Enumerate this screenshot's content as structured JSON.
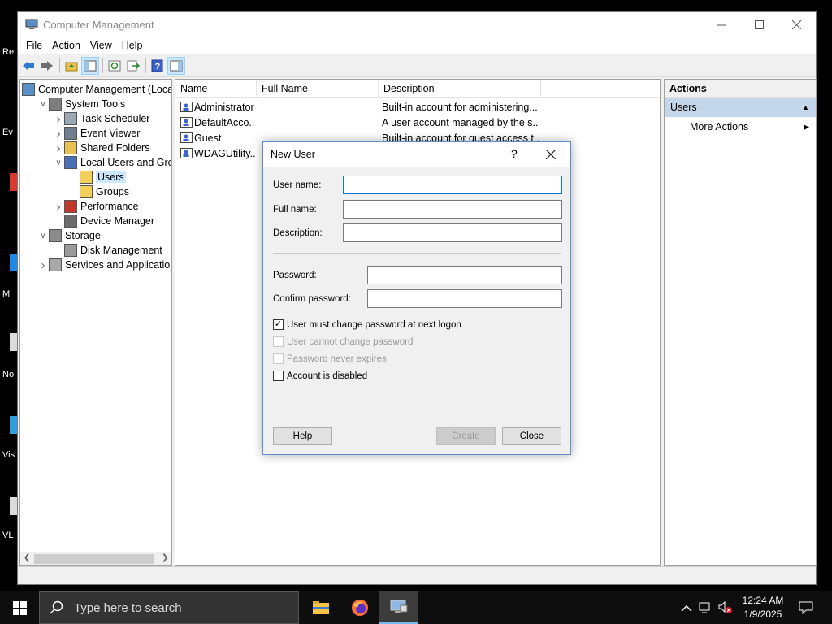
{
  "window": {
    "title": "Computer Management"
  },
  "menu": [
    "File",
    "Action",
    "View",
    "Help"
  ],
  "tree": [
    {
      "label": "Computer Management (Local",
      "level": 0,
      "arrow": "",
      "icon": "computer-mgmt-icon"
    },
    {
      "label": "System Tools",
      "level": 1,
      "arrow": "v",
      "icon": "tools-icon"
    },
    {
      "label": "Task Scheduler",
      "level": 2,
      "arrow": ">",
      "icon": "clock-icon"
    },
    {
      "label": "Event Viewer",
      "level": 2,
      "arrow": ">",
      "icon": "event-viewer-icon"
    },
    {
      "label": "Shared Folders",
      "level": 2,
      "arrow": ">",
      "icon": "shared-folder-icon"
    },
    {
      "label": "Local Users and Groups",
      "level": 2,
      "arrow": "v",
      "icon": "users-groups-icon"
    },
    {
      "label": "Users",
      "level": 3,
      "arrow": "",
      "icon": "folder-icon",
      "selected": true
    },
    {
      "label": "Groups",
      "level": 3,
      "arrow": "",
      "icon": "folder-icon"
    },
    {
      "label": "Performance",
      "level": 2,
      "arrow": ">",
      "icon": "performance-icon"
    },
    {
      "label": "Device Manager",
      "level": 2,
      "arrow": "",
      "icon": "device-manager-icon"
    },
    {
      "label": "Storage",
      "level": 1,
      "arrow": "v",
      "icon": "storage-icon"
    },
    {
      "label": "Disk Management",
      "level": 2,
      "arrow": "",
      "icon": "disk-icon"
    },
    {
      "label": "Services and Applications",
      "level": 1,
      "arrow": ">",
      "icon": "services-icon"
    }
  ],
  "list": {
    "columns": [
      "Name",
      "Full Name",
      "Description"
    ],
    "rows": [
      {
        "name": "Administrator",
        "full_name": "",
        "description": "Built-in account for administering..."
      },
      {
        "name": "DefaultAcco...",
        "full_name": "",
        "description": "A user account managed by the s..."
      },
      {
        "name": "Guest",
        "full_name": "",
        "description": "Built-in account for guest access t..."
      },
      {
        "name": "WDAGUtility...",
        "full_name": "",
        "description": ""
      }
    ]
  },
  "actions": {
    "header": "Actions",
    "section": "Users",
    "more": "More Actions"
  },
  "dialog": {
    "title": "New User",
    "help_glyph": "?",
    "username_label": "User name:",
    "fullname_label": "Full name:",
    "description_label": "Description:",
    "password_label": "Password:",
    "confirm_label": "Confirm password:",
    "username_value": "",
    "fullname_value": "",
    "description_value": "",
    "checkboxes": [
      {
        "label": "User must change password at next logon",
        "checked": true,
        "enabled": true
      },
      {
        "label": "User cannot change password",
        "checked": false,
        "enabled": false
      },
      {
        "label": "Password never expires",
        "checked": false,
        "enabled": false
      },
      {
        "label": "Account is disabled",
        "checked": false,
        "enabled": true
      }
    ],
    "help_button": "Help",
    "create_button": "Create",
    "close_button": "Close"
  },
  "desktop_labels": [
    "Re",
    "Ev",
    "M",
    "No",
    "Vis",
    "VL"
  ],
  "taskbar": {
    "search_placeholder": "Type here to search",
    "time": "12:24 AM",
    "date": "1/9/2025"
  },
  "colors": {
    "selection": "#cce8ff",
    "actions_section": "#c4d7ea",
    "focus_border": "#0078d7",
    "taskbar": "#0e0e0e"
  }
}
